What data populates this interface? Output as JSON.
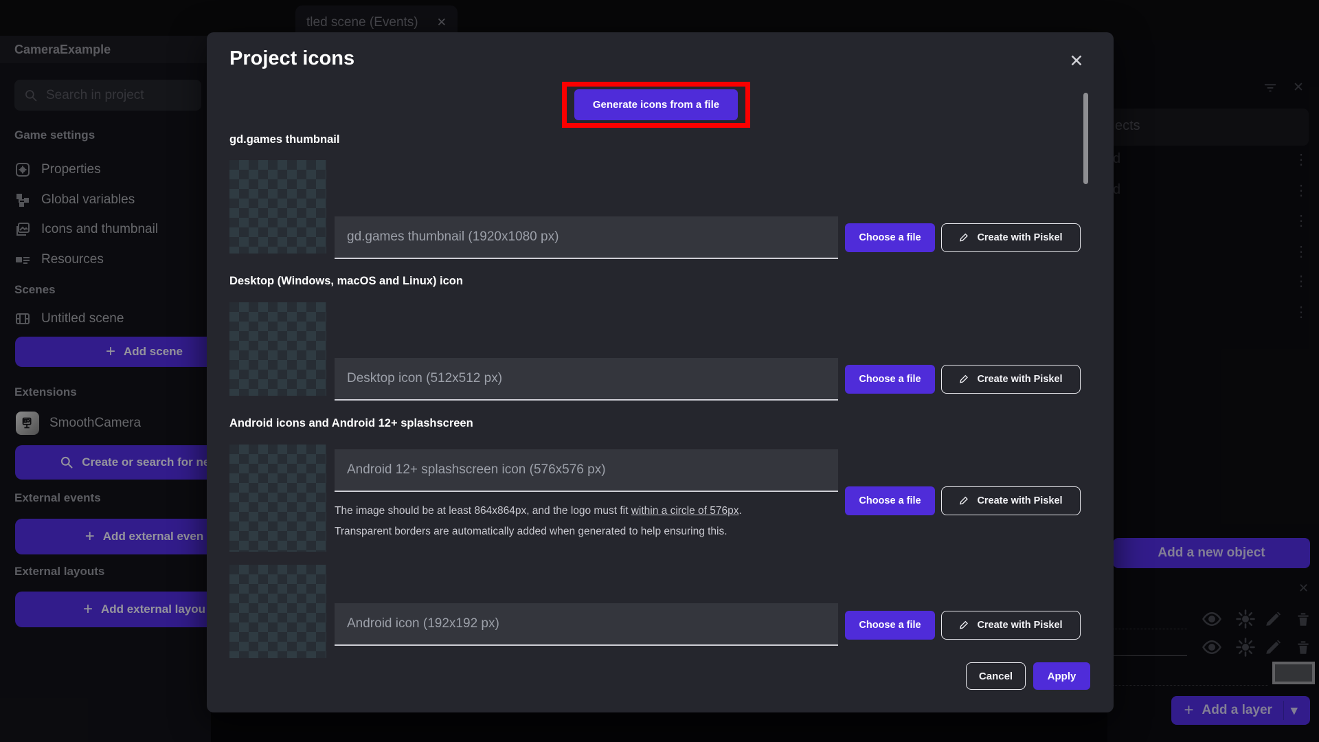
{
  "window": {
    "tab_title": "tled scene (Events)",
    "tab_close": "✕"
  },
  "sidebar": {
    "header": "CameraExample",
    "search_placeholder": "Search in project",
    "game_settings_title": "Game settings",
    "items": {
      "properties": "Properties",
      "global_variables": "Global variables",
      "icons_thumbnail": "Icons and thumbnail",
      "resources": "Resources"
    },
    "scenes_title": "Scenes",
    "untitled_scene": "Untitled scene",
    "add_scene": "Add scene",
    "extensions_title": "Extensions",
    "smooth_camera": "SmoothCamera",
    "create_search_extensions": "Create or search for new e",
    "external_events_title": "External events",
    "add_external_events": "Add external even",
    "external_layouts_title": "External layouts",
    "add_external_layouts": "Add external layou"
  },
  "modal": {
    "title": "Project icons",
    "close": "✕",
    "generate_button": "Generate icons from a file",
    "choose_file": "Choose a file",
    "create_piskel": "Create with Piskel",
    "cancel": "Cancel",
    "apply": "Apply",
    "sections": {
      "thumbnail": {
        "label": "gd.games thumbnail",
        "placeholder": "gd.games thumbnail (1920x1080 px)"
      },
      "desktop": {
        "label": "Desktop (Windows, macOS and Linux) icon",
        "placeholder": "Desktop icon (512x512 px)"
      },
      "android": {
        "label": "Android icons and Android 12+ splashscreen",
        "placeholder": "Android 12+ splashscreen icon (576x576 px)",
        "note_prefix": "The image should be at least 864x864px, and the logo must fit ",
        "note_underlined": "within a circle of 576px",
        "note_suffix": ".",
        "note_line2": "Transparent borders are automatically added when generated to help ensuring this."
      },
      "android_icon": {
        "placeholder": "Android icon (192x192 px)"
      }
    }
  },
  "right_panel": {
    "search_value_visible": "ects",
    "object_row_1": "d",
    "object_row_2": "d",
    "add_new_object": "Add a new object",
    "add_layer": "Add a layer",
    "kebab": "⋮",
    "close": "✕",
    "caret": "▾"
  },
  "toolbar_glyphs": {
    "undo": "↶",
    "redo": "↷"
  },
  "colors": {
    "accent": "#4F2CD9",
    "highlight_red": "#FB0000",
    "modal_bg": "#25262D"
  }
}
